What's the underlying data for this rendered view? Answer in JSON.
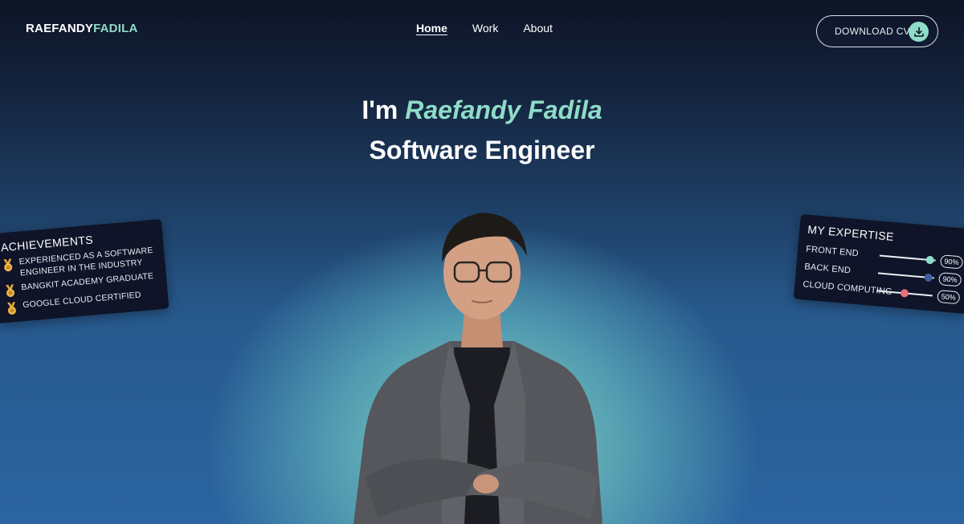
{
  "logo": {
    "first": "RAEFANDY",
    "last": "FADILA"
  },
  "nav": {
    "items": [
      "Home",
      "Work",
      "About"
    ],
    "active": "Home"
  },
  "cv_button": {
    "label": "DOWNLOAD CV",
    "icon": "download-icon"
  },
  "hero": {
    "greeting": "I'm",
    "name": "Raefandy Fadila",
    "role": "Software Engineer"
  },
  "achievements": {
    "title": "ACHIEVEMENTS",
    "icon": "medal-icon",
    "items": [
      {
        "line1": "EXPERIENCED AS A SOFTWARE",
        "line2": "ENGINEER IN THE INDUSTRY"
      },
      {
        "line1": "BANGKIT ACADEMY GRADUATE"
      },
      {
        "line1": "GOOGLE CLOUD CERTIFIED"
      }
    ]
  },
  "expertise": {
    "title": "MY EXPERTISE",
    "skills": [
      {
        "name": "FRONT END",
        "level": 90,
        "label": "90%",
        "color": "#8fdcc8"
      },
      {
        "name": "BACK END",
        "level": 90,
        "label": "90%",
        "color": "#3d5f9e"
      },
      {
        "name": "CLOUD COMPUTING",
        "level": 50,
        "label": "50%",
        "color": "#e86f7a"
      }
    ]
  },
  "colors": {
    "accent": "#8fdcc8",
    "card_bg": "#0f1428"
  }
}
